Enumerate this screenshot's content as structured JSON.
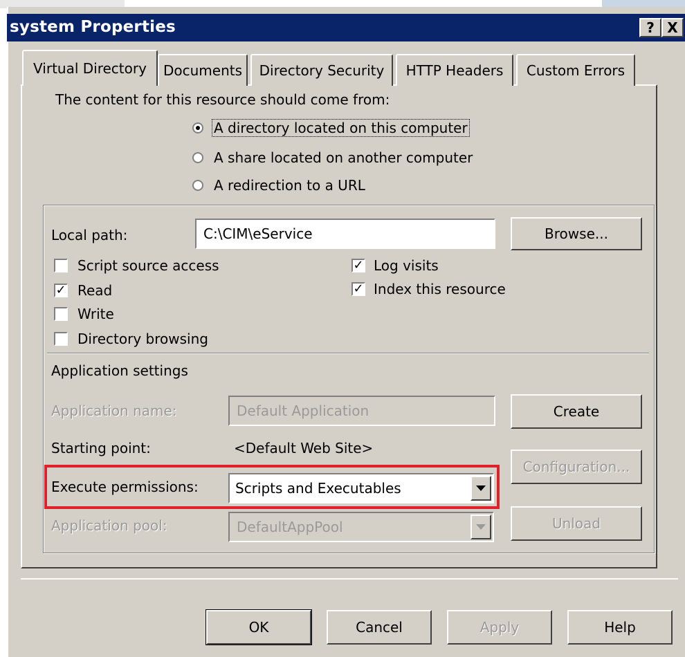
{
  "window": {
    "title": "system Properties",
    "help_button": "?",
    "close_button": "X"
  },
  "tabs": [
    {
      "label": "Virtual Directory",
      "active": true
    },
    {
      "label": "Documents",
      "active": false
    },
    {
      "label": "Directory Security",
      "active": false
    },
    {
      "label": "HTTP Headers",
      "active": false
    },
    {
      "label": "Custom Errors",
      "active": false
    }
  ],
  "source": {
    "prompt": "The content for this resource should come from:",
    "options": [
      {
        "label": "A directory located on this computer",
        "selected": true
      },
      {
        "label": "A share located on another computer",
        "selected": false
      },
      {
        "label": "A redirection to a URL",
        "selected": false
      }
    ]
  },
  "local_path": {
    "label": "Local path:",
    "value": "C:\\CIM\\eService",
    "browse_label": "Browse..."
  },
  "checkboxes_left": [
    {
      "label": "Script source access",
      "checked": false
    },
    {
      "label": "Read",
      "checked": true
    },
    {
      "label": "Write",
      "checked": false
    },
    {
      "label": "Directory browsing",
      "checked": false
    }
  ],
  "checkboxes_right": [
    {
      "label": "Log visits",
      "checked": true
    },
    {
      "label": "Index this resource",
      "checked": true
    }
  ],
  "app_settings": {
    "heading": "Application settings",
    "app_name_label": "Application name:",
    "app_name_value": "Default Application",
    "create_label": "Create",
    "starting_point_label": "Starting point:",
    "starting_point_value": "<Default Web Site>",
    "configuration_label": "Configuration...",
    "execute_label": "Execute permissions:",
    "execute_value": "Scripts and Executables",
    "pool_label": "Application pool:",
    "pool_value": "DefaultAppPool",
    "unload_label": "Unload"
  },
  "footer": {
    "ok": "OK",
    "cancel": "Cancel",
    "apply": "Apply",
    "help": "Help"
  },
  "colors": {
    "titlebar": "#0a246a",
    "dialog_bg": "#d4d0c8",
    "highlight_box": "#e0212a"
  }
}
